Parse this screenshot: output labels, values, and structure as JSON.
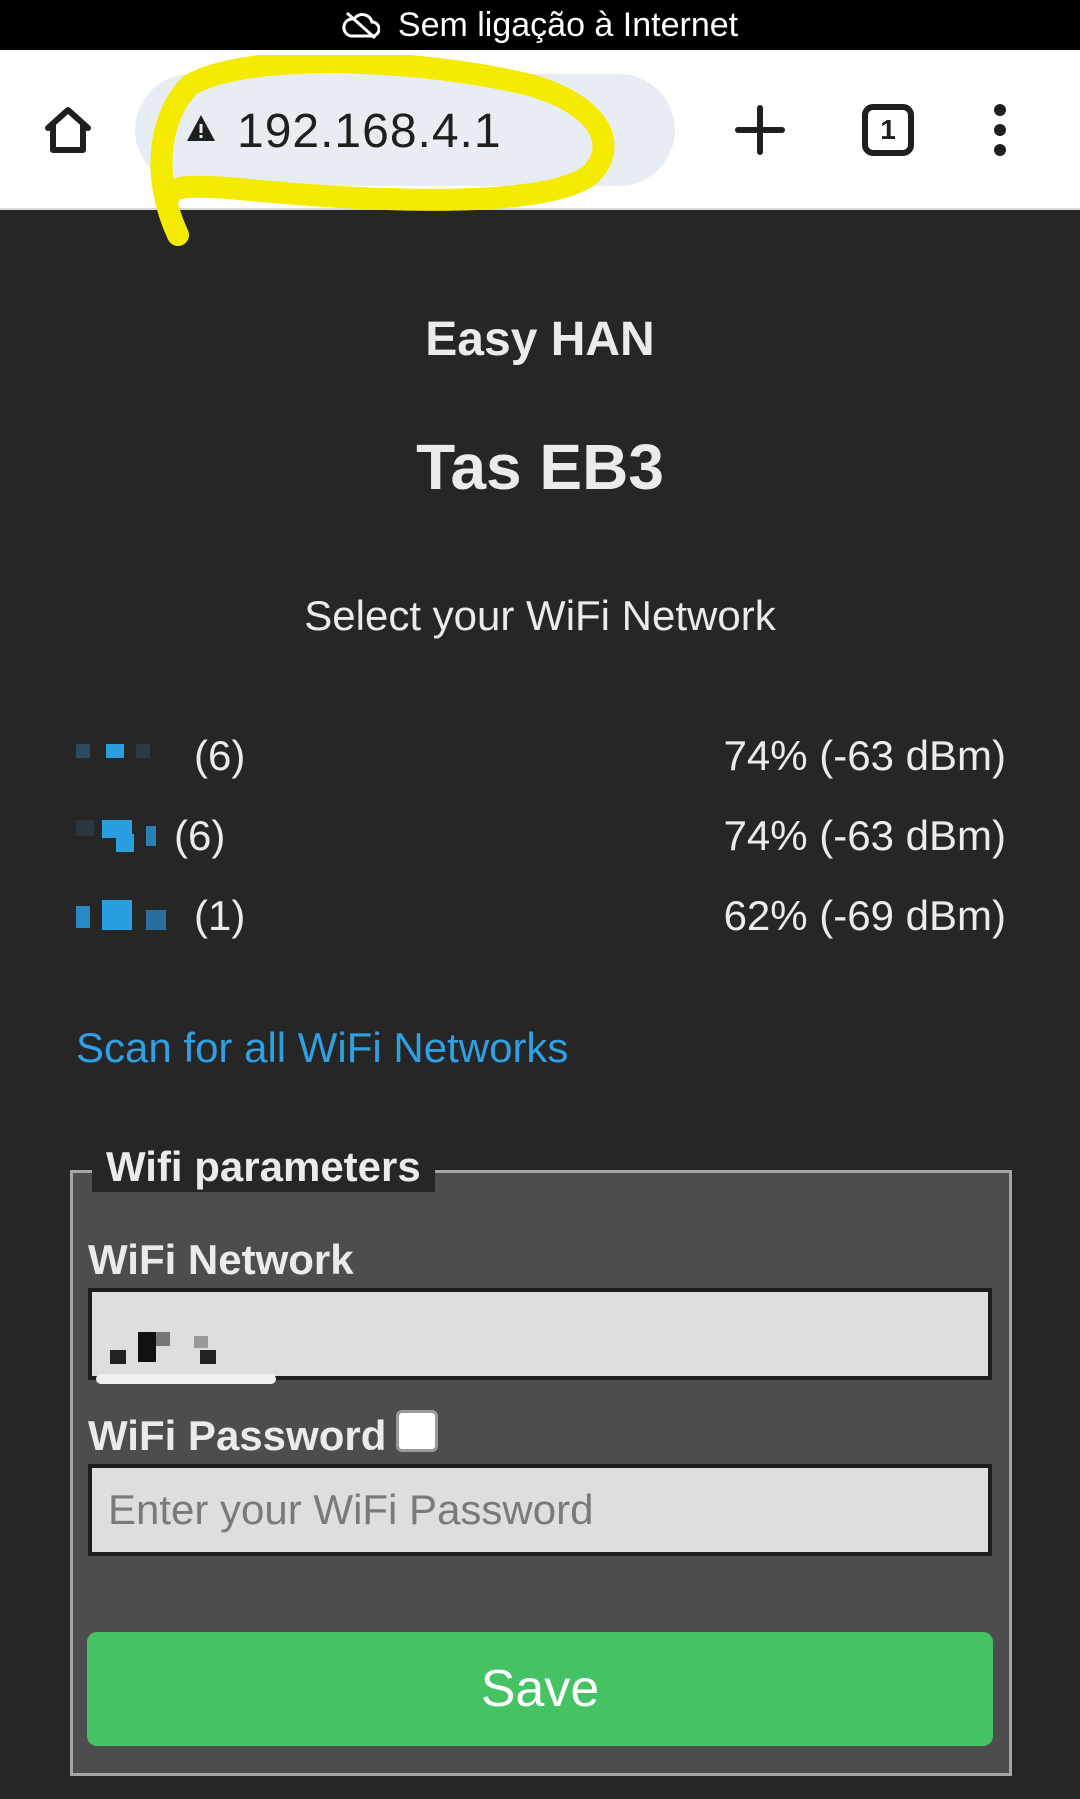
{
  "status_bar": {
    "text": "Sem ligação à Internet",
    "icon": "cloud-off-icon"
  },
  "browser": {
    "url": "192.168.4.1",
    "icons": [
      "home-icon",
      "warning-icon",
      "plus-icon",
      "tabs-icon",
      "more-vert-icon"
    ],
    "tab_count": "1",
    "highlight_color": "#f5eb00"
  },
  "page": {
    "subtitle": "Easy HAN",
    "title": "Tas EB3",
    "select_label": "Select your WiFi Network",
    "networks": [
      {
        "channel": "(6)",
        "signal": "74% (-63 dBm)"
      },
      {
        "channel": "(6)",
        "signal": "74% (-63 dBm)"
      },
      {
        "channel": "(1)",
        "signal": "62% (-69 dBm)"
      }
    ],
    "scan_link": "Scan for all WiFi Networks",
    "form": {
      "legend": "Wifi parameters",
      "network_label": "WiFi Network",
      "password_label": "WiFi Password",
      "password_placeholder": "Enter your WiFi Password",
      "save_label": "Save"
    }
  },
  "colors": {
    "background": "#262626",
    "link": "#2fa0e4",
    "save_button": "#45c263",
    "fieldset_bg": "#4d4d4d"
  }
}
